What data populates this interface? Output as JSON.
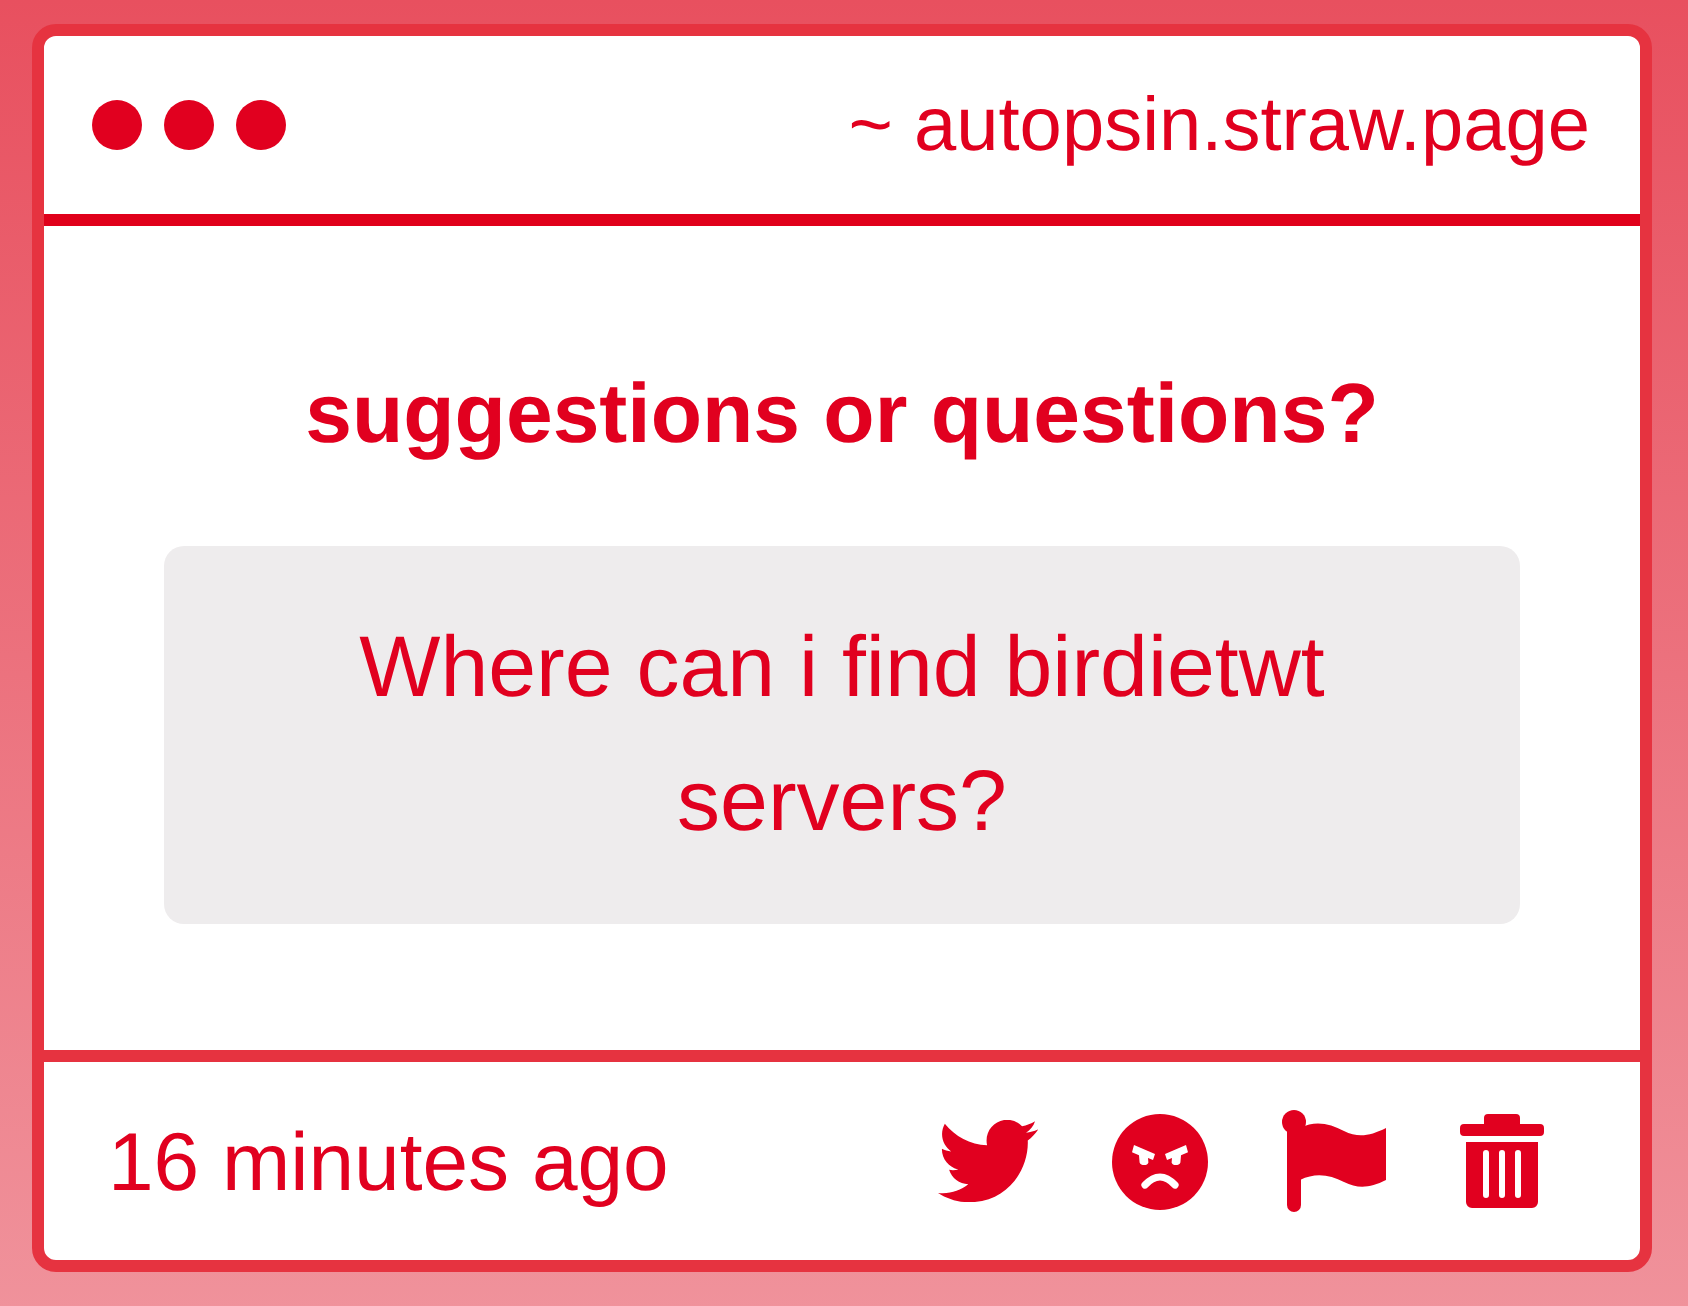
{
  "window": {
    "url": "~ autopsin.straw.page"
  },
  "question": {
    "heading": "suggestions or questions?",
    "text": "Where can i find birdietwt servers?"
  },
  "footer": {
    "time": "16 minutes ago",
    "actions": [
      {
        "kind": "twitter"
      },
      {
        "kind": "angry"
      },
      {
        "kind": "flag"
      },
      {
        "kind": "delete"
      }
    ]
  }
}
